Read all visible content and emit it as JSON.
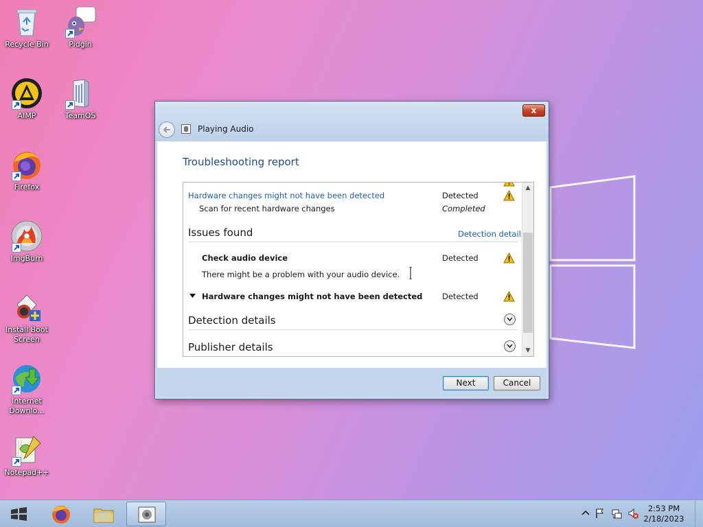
{
  "desktop": {
    "icons": [
      {
        "label": "Recycle Bin",
        "icon": "recycle-bin-icon"
      },
      {
        "label": "Pidgin",
        "icon": "pidgin-icon"
      },
      {
        "label": "AIMP",
        "icon": "aimp-icon"
      },
      {
        "label": "TeamOS",
        "icon": "teamos-icon"
      },
      {
        "label": "Firefox",
        "icon": "firefox-icon"
      },
      {
        "label": "ImgBurn",
        "icon": "imgburn-icon"
      },
      {
        "label": "Install Boot Screen",
        "icon": "install-boot-screen-icon"
      },
      {
        "label": "Internet Downlo...",
        "icon": "internet-download-manager-icon"
      },
      {
        "label": "Notepad++",
        "icon": "notepadpp-icon"
      }
    ]
  },
  "dialog": {
    "title": "Playing Audio",
    "close_label": "x",
    "heading": "Troubleshooting report",
    "top_item": {
      "title": "Hardware changes might not have been detected",
      "status": "Detected",
      "sub_label": "Scan for recent hardware changes",
      "sub_status": "Completed"
    },
    "issues_section": {
      "title": "Issues found",
      "link": "Detection details",
      "items": [
        {
          "title": "Check audio device",
          "status": "Detected",
          "description": "There might be a problem with your audio device."
        },
        {
          "title": "Hardware changes might not have been detected",
          "status": "Detected"
        }
      ]
    },
    "detection_details_label": "Detection details",
    "publisher_details_label": "Publisher details",
    "next_label": "Next",
    "cancel_label": "Cancel"
  },
  "taskbar": {
    "items": [
      "start-button",
      "firefox",
      "file-explorer",
      "troubleshooter"
    ],
    "clock": {
      "time": "2:53 PM",
      "date": "2/18/2023"
    }
  },
  "colors": {
    "link": "#1d5fa8",
    "heading": "#1c4f8c",
    "warning": "#f2c20f"
  }
}
